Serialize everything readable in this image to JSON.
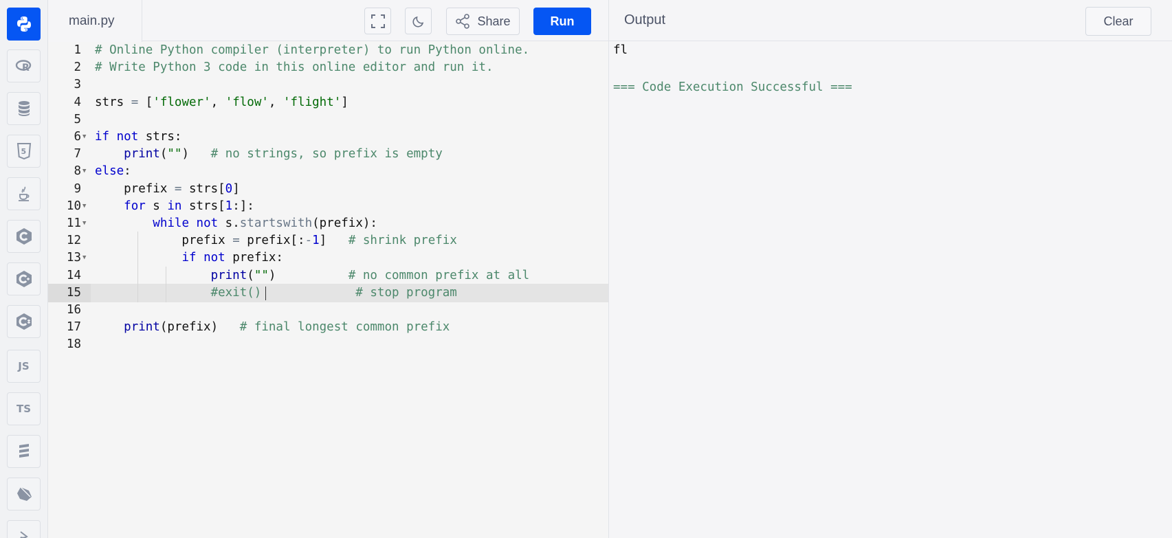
{
  "sidebar": {
    "languages": [
      {
        "name": "python",
        "label": "",
        "icon": "python-icon"
      },
      {
        "name": "r",
        "label": "R",
        "icon": "r-icon"
      },
      {
        "name": "sql",
        "label": "",
        "icon": "database-icon"
      },
      {
        "name": "html",
        "label": "5",
        "icon": "html5-icon"
      },
      {
        "name": "java",
        "label": "",
        "icon": "java-icon"
      },
      {
        "name": "c",
        "label": "C",
        "icon": "c-icon"
      },
      {
        "name": "cpp",
        "label": "C",
        "icon": "cpp-icon"
      },
      {
        "name": "csharp",
        "label": "C",
        "icon": "csharp-icon"
      },
      {
        "name": "javascript",
        "label": "JS",
        "icon": "js-icon"
      },
      {
        "name": "typescript",
        "label": "TS",
        "icon": "ts-icon"
      },
      {
        "name": "stack",
        "label": "",
        "icon": "layers-icon"
      },
      {
        "name": "dart",
        "label": "",
        "icon": "dart-icon"
      },
      {
        "name": "swift",
        "label": "",
        "icon": "swift-icon"
      }
    ]
  },
  "editor": {
    "file_name": "main.py",
    "share_label": "Share",
    "run_label": "Run",
    "current_line": 15,
    "lines": [
      {
        "n": "1",
        "text": "# Online Python compiler (interpreter) to run Python online."
      },
      {
        "n": "2",
        "text": "# Write Python 3 code in this online editor and run it."
      },
      {
        "n": "3",
        "text": ""
      },
      {
        "n": "4",
        "text": "strs = ['flower', 'flow', 'flight']"
      },
      {
        "n": "5",
        "text": ""
      },
      {
        "n": "6",
        "text": "if not strs:"
      },
      {
        "n": "7",
        "text": "    print(\"\")   # no strings, so prefix is empty"
      },
      {
        "n": "8",
        "text": "else:"
      },
      {
        "n": "9",
        "text": "    prefix = strs[0]"
      },
      {
        "n": "10",
        "text": "    for s in strs[1:]:"
      },
      {
        "n": "11",
        "text": "        while not s.startswith(prefix):"
      },
      {
        "n": "12",
        "text": "            prefix = prefix[:-1]   # shrink prefix"
      },
      {
        "n": "13",
        "text": "            if not prefix:"
      },
      {
        "n": "14",
        "text": "                print(\"\")          # no common prefix at all"
      },
      {
        "n": "15",
        "text": "                #exit()             # stop program"
      },
      {
        "n": "16",
        "text": ""
      },
      {
        "n": "17",
        "text": "    print(prefix)   # final longest common prefix"
      },
      {
        "n": "18",
        "text": ""
      }
    ]
  },
  "output": {
    "title": "Output",
    "clear_label": "Clear",
    "lines": [
      "fl",
      "",
      "=== Code Execution Successful ==="
    ]
  },
  "colors": {
    "accent": "#0556f3",
    "keyword": "#0000cd",
    "string": "#036a07",
    "comment": "#4c886b"
  }
}
